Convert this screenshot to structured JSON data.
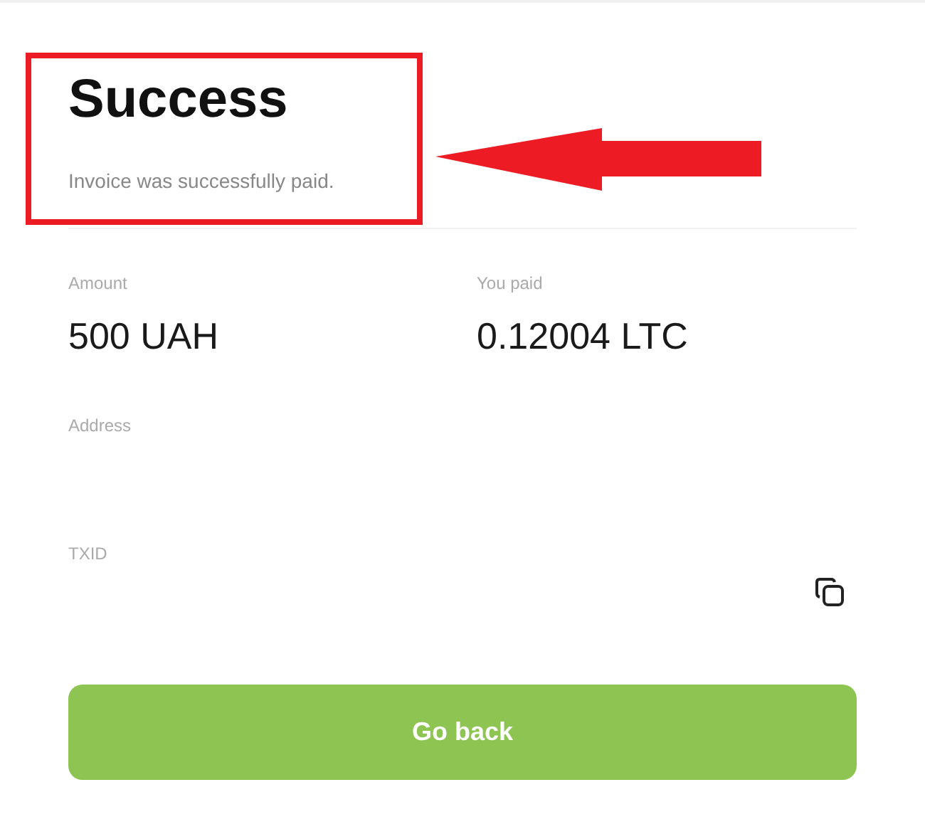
{
  "header": {
    "title": "Success",
    "subtitle": "Invoice was successfully paid."
  },
  "details": [
    {
      "label": "Amount",
      "value": "500 UAH"
    },
    {
      "label": "You paid",
      "value": "0.12004 LTC"
    }
  ],
  "address": {
    "label": "Address"
  },
  "txid": {
    "label": "TXID"
  },
  "button": {
    "label": "Go back"
  },
  "annotation": {
    "kind": "highlight-arrow"
  }
}
